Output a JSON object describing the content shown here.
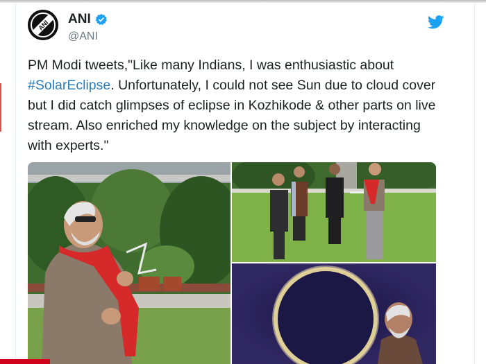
{
  "tweet": {
    "display_name": "ANI",
    "handle": "@ANI",
    "avatar_text": "ANI",
    "text_before": "PM Modi tweets,\"Like many Indians, I was enthusiastic about ",
    "hashtag": "#SolarEclipse",
    "text_after": ". Unfortunately, I could not see Sun due to cloud cover but I did catch glimpses of eclipse in Kozhikode & other parts on live stream. Also enriched my knowledge on the subject by interacting with experts.\""
  },
  "icons": {
    "verified": "verified-badge-icon",
    "platform": "bird-icon"
  },
  "colors": {
    "link": "#2b7bb9",
    "verified": "#1da1f2",
    "bird": "#1da1f2",
    "handle": "#697882"
  }
}
